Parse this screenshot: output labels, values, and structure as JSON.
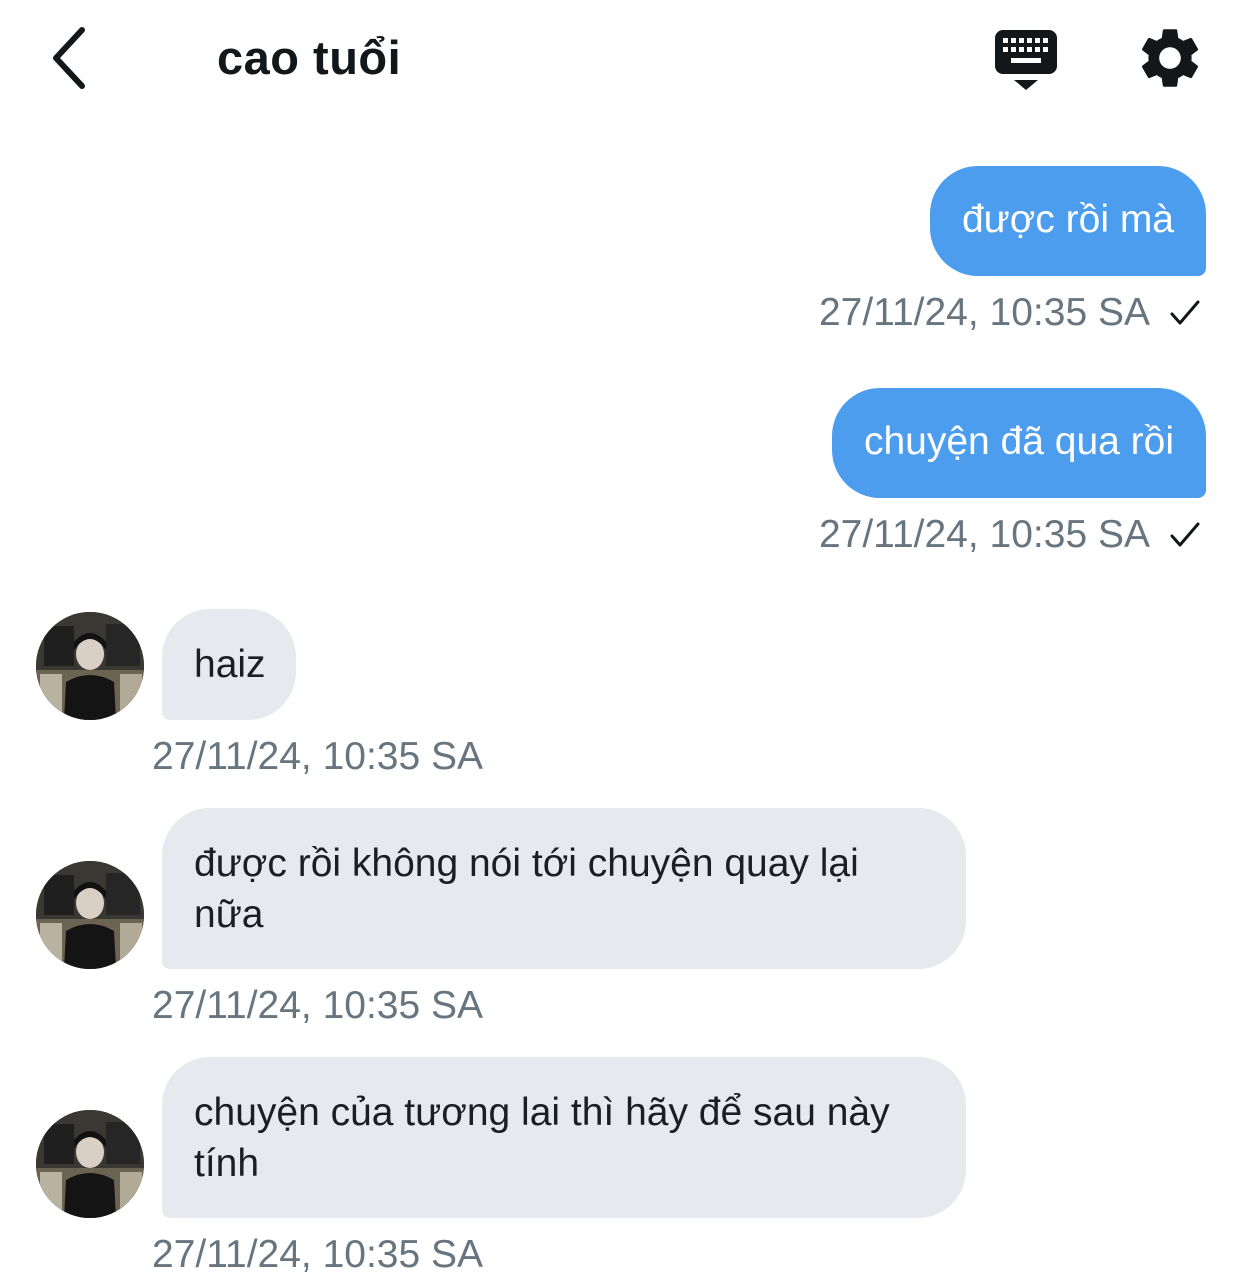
{
  "header": {
    "title": "cao tuổi",
    "back_icon": "chevron-left-icon",
    "keyboard_icon": "keyboard-icon",
    "settings_icon": "gear-icon"
  },
  "colors": {
    "outgoing_bubble": "#4c9ded",
    "incoming_bubble": "#e6e9ee",
    "timestamp": "#66757f"
  },
  "messages": [
    {
      "direction": "out",
      "text": "được rồi mà",
      "time": "27/11/24, 10:35 SA",
      "status_icon": "check-icon"
    },
    {
      "direction": "out",
      "text": "chuyện đã qua rồi",
      "time": "27/11/24, 10:35 SA",
      "status_icon": "check-icon"
    },
    {
      "direction": "in",
      "text": "haiz",
      "time": "27/11/24, 10:35 SA"
    },
    {
      "direction": "in",
      "text": "được rồi không nói tới chuyện quay lại nữa",
      "time": "27/11/24, 10:35 SA"
    },
    {
      "direction": "in",
      "text": "chuyện của tương lai thì hãy để sau này tính",
      "time": "27/11/24, 10:35 SA"
    }
  ]
}
